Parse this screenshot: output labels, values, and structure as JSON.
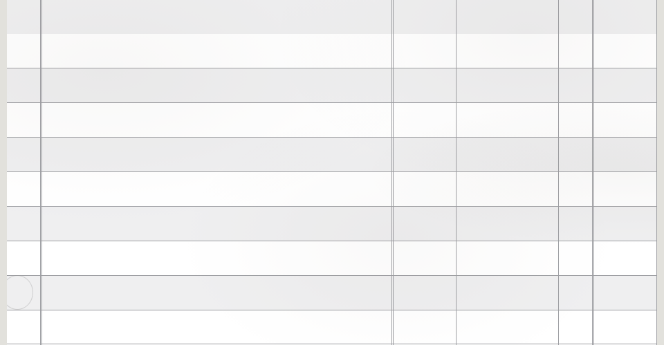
{
  "ledger": {
    "row_count": 10,
    "column_count": 6,
    "colors": {
      "shaded_row": "#efeff0",
      "plain_row": "#ffffff",
      "rule_line": "#9d9ea2",
      "margin": "#e2e1dc"
    }
  }
}
